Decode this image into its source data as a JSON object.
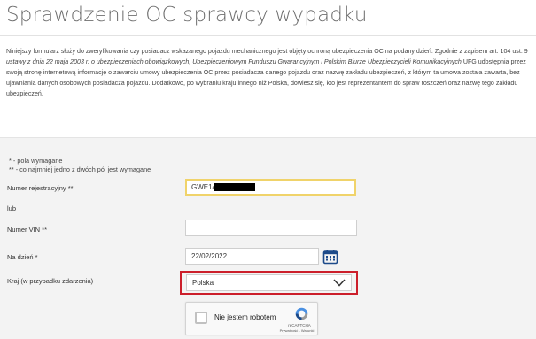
{
  "page": {
    "title": "Sprawdzenie OC sprawcy wypadku",
    "intro": {
      "p1": "Niniejszy formularz służy do zweryfikowania czy posiadacz wskazanego pojazdu mechanicznego jest objęty ochroną ubezpieczenia OC na podany dzień. Zgodnie z zapisem art. 104 ust. 9 ",
      "p2_italic": "ustawy z dnia 22 maja 2003 r. o ubezpieczeniach obowiązkowych, Ubezpieczeniowym Funduszu Gwarancyjnym i Polskim Biurze Ubezpieczycieli Komunikacyjnych",
      "p3": " UFG udostępnia przez swoją stronę internetową informację o zawarciu umowy ubezpieczenia OC przez posiadacza danego pojazdu oraz nazwę zakładu ubezpieczeń, z którym ta umowa została zawarta, bez ujawniania danych osobowych posiadacza pojazdu. Dodatkowo, po wybraniu kraju innego niż Polska, dowiesz się, kto jest reprezentantem do spraw roszczeń oraz nazwę tego zakładu ubezpieczeń."
    }
  },
  "form": {
    "notes": {
      "required": "* - pola wymagane",
      "either": "** - co najmniej jedno z dwóch pól jest wymagane"
    },
    "registration": {
      "label": "Numer rejestracyjny **",
      "value": "GWE14"
    },
    "or_label": "lub",
    "vin": {
      "label": "Numer VIN **",
      "value": ""
    },
    "date": {
      "label": "Na dzień *",
      "value": "22/02/2022",
      "icon": "calendar-icon"
    },
    "country": {
      "label": "Kraj (w przypadku zdarzenia)",
      "value": "Polska",
      "icon": "chevron-down-icon"
    },
    "captcha": {
      "label": "Nie jestem robotem",
      "brand": "reCAPTCHA",
      "links": "Prywatność - Warunki",
      "icon": "recaptcha-logo-icon"
    }
  },
  "colors": {
    "title": "#707070",
    "focus_border": "#f0d36a",
    "highlight": "#cc1f2b",
    "calendar": "#1c4a8a",
    "form_bg": "#f3f3f3"
  }
}
